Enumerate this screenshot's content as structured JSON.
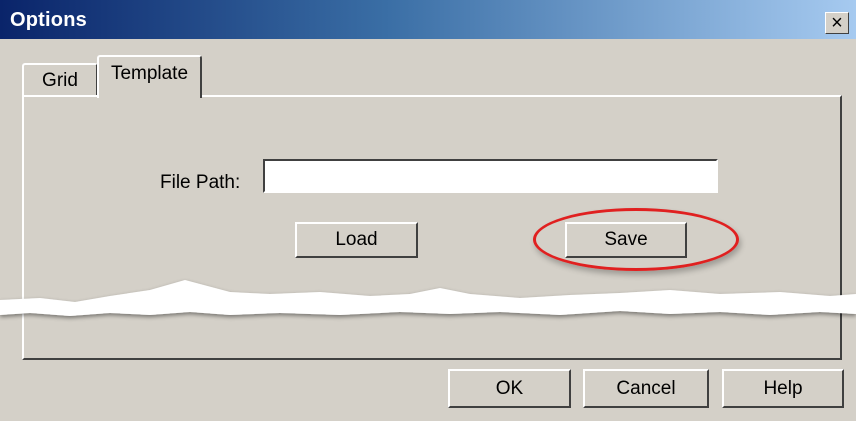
{
  "window": {
    "title": "Options",
    "close_glyph": "×"
  },
  "tabs": [
    {
      "label": "Grid",
      "selected": false
    },
    {
      "label": "Template",
      "selected": true
    }
  ],
  "template_tab": {
    "file_path_label": "File Path:",
    "file_path_value": "",
    "load_label": "Load",
    "save_label": "Save"
  },
  "footer": {
    "ok_label": "OK",
    "cancel_label": "Cancel",
    "help_label": "Help"
  },
  "annotation": {
    "highlight_color": "#e02020",
    "highlights": "save-button"
  },
  "colors": {
    "dialog_bg": "#d4d0c8",
    "title_gradient_start": "#0a246a",
    "title_gradient_end": "#a6caf0"
  }
}
